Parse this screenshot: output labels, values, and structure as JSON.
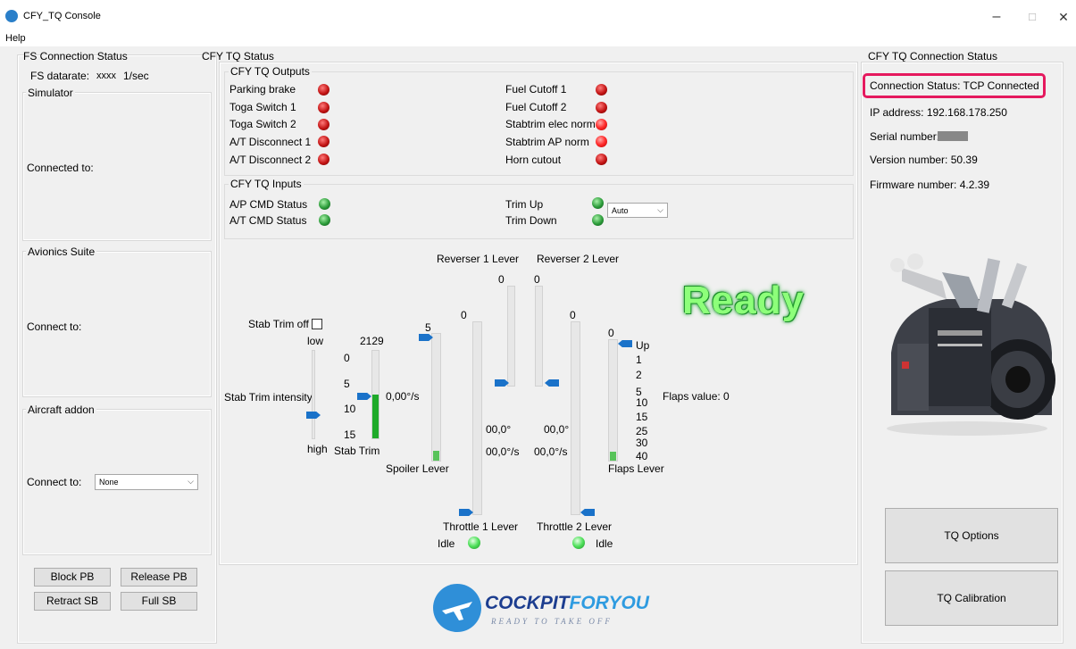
{
  "window": {
    "title": "CFY_TQ Console",
    "minimize": "–",
    "maximize": "□",
    "close": "✕"
  },
  "menu": {
    "help": "Help"
  },
  "left": {
    "title": "FS Connection Status",
    "datarate_label": "FS datarate:",
    "datarate_value": "xxxx",
    "datarate_unit": "1/sec",
    "simulator": {
      "title": "Simulator",
      "connected_label": "Connected to:"
    },
    "avionics": {
      "title": "Avionics Suite",
      "connect_label": "Connect to:"
    },
    "aircraft": {
      "title": "Aircraft addon",
      "connect_label": "Connect to:",
      "select_value": "None"
    },
    "buttons": {
      "block_pb": "Block PB",
      "release_pb": "Release PB",
      "retract_sb": "Retract SB",
      "full_sb": "Full SB"
    }
  },
  "status": {
    "title": "CFY TQ Status",
    "outputs": {
      "title": "CFY TQ Outputs",
      "left": [
        {
          "label": "Parking brake"
        },
        {
          "label": "Toga Switch 1"
        },
        {
          "label": "Toga Switch 2"
        },
        {
          "label": "A/T Disconnect 1"
        },
        {
          "label": "A/T Disconnect 2"
        }
      ],
      "right": [
        {
          "label": "Fuel Cutoff 1"
        },
        {
          "label": "Fuel Cutoff 2"
        },
        {
          "label": "Stabtrim elec norm"
        },
        {
          "label": "Stabtrim AP norm"
        },
        {
          "label": "Horn cutout"
        }
      ]
    },
    "inputs": {
      "title": "CFY TQ Inputs",
      "ap_cmd": "A/P CMD Status",
      "at_cmd": "A/T CMD Status",
      "trim_up": "Trim Up",
      "trim_down": "Trim Down",
      "trim_mode": "Auto"
    },
    "stab_trim_off": "Stab Trim off",
    "stab_intensity": {
      "label": "Stab Trim intensity",
      "low": "low",
      "high": "high",
      "level": 0.8
    },
    "stab_trim": {
      "value": "2129",
      "label": "Stab Trim",
      "rate": "0,00°/s",
      "ticks": [
        "0",
        "5",
        "10",
        "15"
      ],
      "fill": 0.5
    },
    "spoiler": {
      "top": "5",
      "label": "Spoiler Lever"
    },
    "reverser1": {
      "label": "Reverser 1 Lever",
      "value": "0"
    },
    "reverser2": {
      "label": "Reverser 2 Lever",
      "value": "0"
    },
    "throttle1": {
      "top": "0",
      "label": "Throttle 1 Lever",
      "angle": "00,0°",
      "rate": "00,0°/s",
      "idle": "Idle"
    },
    "throttle2": {
      "top": "0",
      "label": "Throttle 2 Lever",
      "angle": "00,0°",
      "rate": "00,0°/s",
      "idle": "Idle"
    },
    "flaps": {
      "top": "0",
      "label": "Flaps Lever",
      "value_text": "Flaps value: 0",
      "ticks": [
        "Up",
        "1",
        "2",
        "5",
        "10",
        "15",
        "25",
        "30",
        "40"
      ]
    },
    "ready": "Ready",
    "logo": {
      "name": "COCKPITFORYOU",
      "name_a": "COCKPIT",
      "name_b": "FORYOU",
      "tagline": "READY TO TAKE OFF"
    }
  },
  "conn": {
    "title": "CFY TQ Connection Status",
    "status": "Connection Status: TCP Connected",
    "ip": "IP address: 192.168.178.250",
    "serial_label": "Serial number:",
    "version": "Version number: 50.39",
    "firmware": "Firmware number: 4.2.39",
    "options_btn": "TQ Options",
    "calibration_btn": "TQ Calibration"
  },
  "colors": {
    "accent": "#1a72c9",
    "highlight": "#e5195e",
    "fill_green": "#1faa2a"
  }
}
